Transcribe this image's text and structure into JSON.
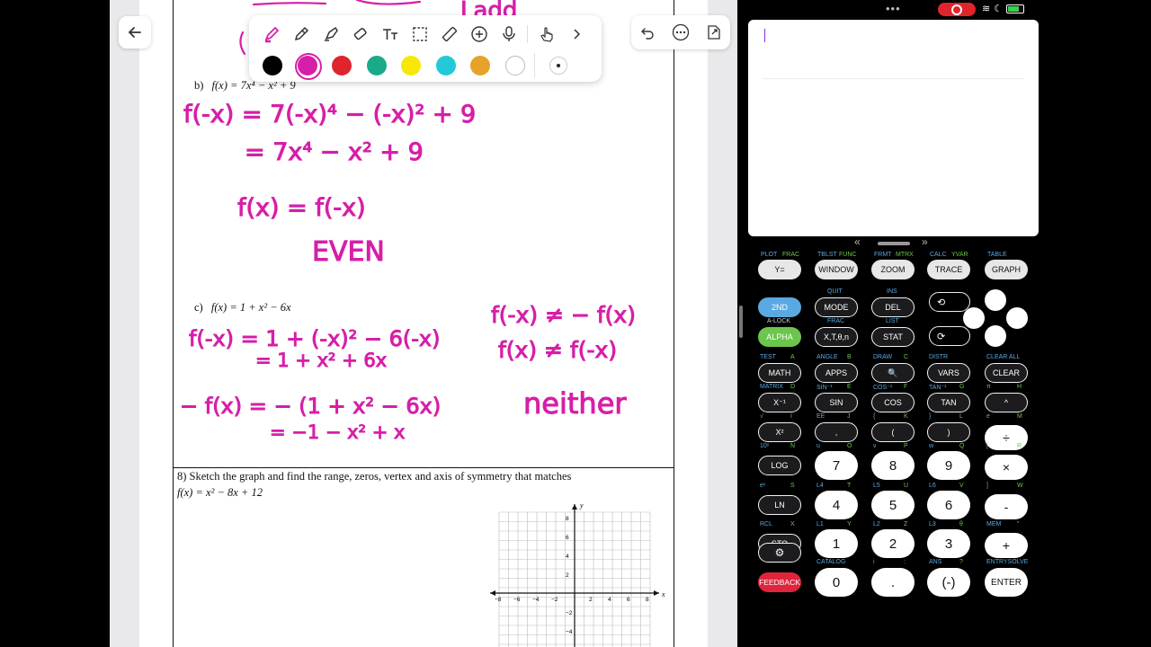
{
  "toolbar": {
    "tools": [
      "pen",
      "pencil",
      "highlighter",
      "eraser",
      "text",
      "lasso-select",
      "ruler",
      "add",
      "microphone",
      "touch-draw",
      "more"
    ],
    "colors": [
      "#000000",
      "#d61fa8",
      "#e0242c",
      "#1aaa8a",
      "#f6e800",
      "#23c9d6",
      "#e6a229",
      "#ffffff"
    ],
    "selected_color": "#d61fa8"
  },
  "nav": {
    "back_icon": "back-arrow-icon",
    "undo_icon": "undo-icon",
    "more_icon": "ellipsis-icon",
    "export_icon": "export-icon"
  },
  "worksheet": {
    "problem_b": {
      "label": "b)",
      "func": "f(x) = 7x⁴ − x² + 9"
    },
    "problem_c": {
      "label": "c)",
      "func": "f(x) = 1 + x² − 6x"
    },
    "problem_8": {
      "title": "8) Sketch the graph and find the range, zeros, vertex and axis of symmetry that matches",
      "func": "f(x) = x² − 8x + 12"
    },
    "grid": {
      "x_ticks": [
        "−8",
        "−6",
        "−4",
        "−2",
        "2",
        "4",
        "6",
        "8"
      ],
      "y_ticks": [
        "8",
        "6",
        "4",
        "2",
        "−2",
        "−4"
      ],
      "x_label": "x",
      "y_label": "y"
    }
  },
  "handwriting": {
    "top_partial": "Ladd",
    "b_line1": "f(-x) = 7(-x)⁴ − (-x)² + 9",
    "b_line2": "= 7x⁴ − x² + 9",
    "b_line3": "f(x) = f(-x)",
    "b_result": "EVEN",
    "c_line1": "f(-x) = 1 + (-x)² − 6(-x)",
    "c_line2": "= 1 + x² + 6x",
    "c_line3": "− f(x) = − (1 + x² − 6x)",
    "c_line4": "= −1 − x² +   x",
    "c_side1": "f(-x) ≠ − f(x)",
    "c_side2": "f(x) ≠ f(-x)",
    "c_result": "neither"
  },
  "calculator": {
    "row1": {
      "keys": [
        "Y=",
        "WINDOW",
        "ZOOM",
        "TRACE",
        "GRAPH"
      ],
      "labels": [
        [
          "PLOT",
          "FRAC"
        ],
        [
          "TBLST",
          "FUNC"
        ],
        [
          "FRMT",
          "MTRX"
        ],
        [
          "CALC",
          "YVAR"
        ],
        [
          "TABLE",
          ""
        ]
      ]
    },
    "row2": {
      "keys": [
        "2ND",
        "MODE",
        "DEL"
      ],
      "labels": [
        "",
        "QUIT",
        "INS"
      ]
    },
    "row3": {
      "keys": [
        "ALPHA",
        "X,T,θ,n",
        "STAT"
      ],
      "labels": [
        "A-LOCK",
        "FRAC",
        "LIST"
      ]
    },
    "row4": {
      "keys": [
        "MATH",
        "APPS",
        "🔍",
        "VARS",
        "CLEAR"
      ],
      "labels": [
        [
          "TEST",
          "A"
        ],
        [
          "ANGLE",
          "B"
        ],
        [
          "DRAW",
          "C"
        ],
        [
          "DISTR",
          ""
        ],
        [
          "CLEAR ALL",
          ""
        ]
      ]
    },
    "row5": {
      "keys": [
        "X⁻¹",
        "SIN",
        "COS",
        "TAN",
        "^"
      ],
      "labels": [
        [
          "MATRIX",
          "D"
        ],
        [
          "SIN⁻¹",
          "E"
        ],
        [
          "COS⁻¹",
          "F"
        ],
        [
          "TAN⁻¹",
          "G"
        ],
        [
          "π",
          "H"
        ]
      ]
    },
    "row6": {
      "keys": [
        "X²",
        ",",
        "(",
        ")",
        "÷"
      ],
      "labels": [
        [
          "√",
          "I"
        ],
        [
          "EE",
          "J"
        ],
        [
          "{",
          "K"
        ],
        [
          "}",
          "L"
        ],
        [
          "e",
          "M"
        ]
      ]
    },
    "row7": {
      "keys": [
        "LOG",
        "7",
        "8",
        "9",
        "×"
      ],
      "labels": [
        [
          "10ˣ",
          "N"
        ],
        [
          "u",
          "O"
        ],
        [
          "v",
          "P"
        ],
        [
          "w",
          "Q"
        ],
        [
          "[",
          "R"
        ]
      ]
    },
    "row8": {
      "keys": [
        "LN",
        "4",
        "5",
        "6",
        "-"
      ],
      "labels": [
        [
          "eˣ",
          "S"
        ],
        [
          "L4",
          "T"
        ],
        [
          "L5",
          "U"
        ],
        [
          "L6",
          "V"
        ],
        [
          "]",
          "W"
        ]
      ]
    },
    "row9": {
      "keys": [
        "STO",
        "1",
        "2",
        "3",
        "+"
      ],
      "labels": [
        [
          "RCL",
          "X"
        ],
        [
          "L1",
          "Y"
        ],
        [
          "L2",
          "Z"
        ],
        [
          "L3",
          "θ"
        ],
        [
          "MEM",
          "\""
        ]
      ]
    },
    "row10": {
      "keys": [
        "⚙",
        "0",
        ".",
        "(-)",
        "ENTER"
      ],
      "labels": [
        [
          "",
          ""
        ],
        [
          "CATALOG",
          ""
        ],
        [
          "i",
          ":"
        ],
        [
          "ANS",
          "?"
        ],
        [
          "ENTRYSOLVE",
          ""
        ]
      ]
    },
    "feedback": "FEEDBACK"
  }
}
